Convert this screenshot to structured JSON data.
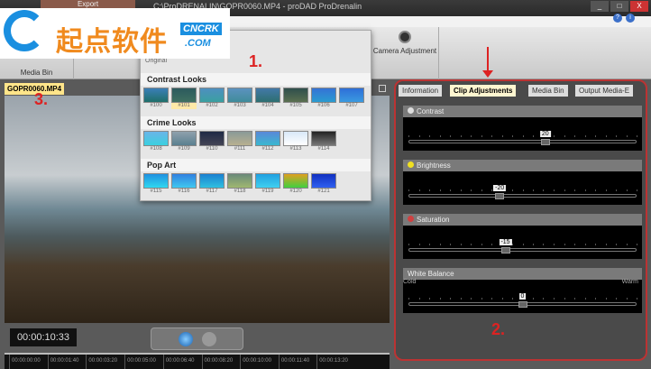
{
  "titlebar": {
    "export_tab": "Export",
    "title": "C:\\ProDRENALIN\\GOPR0060.MP4 - proDAD ProDrenalin",
    "minimize": "_",
    "maximize": "□",
    "close": "X"
  },
  "watermark": {
    "brand_cn": "起点软件",
    "brand_en": "CNCRK",
    "domain": ".COM"
  },
  "ribbon": {
    "media_bin": "Media Bin",
    "camera_adjustment": "Camera Adjustment",
    "original": "Original"
  },
  "popup": {
    "annotation": "1.",
    "sections": [
      {
        "title": "Contrast Looks",
        "items": [
          "#100",
          "#101",
          "#102",
          "#103",
          "#104",
          "#105",
          "#106",
          "#107"
        ]
      },
      {
        "title": "Crime Looks",
        "items": [
          "#108",
          "#109",
          "#110",
          "#111",
          "#112",
          "#113",
          "#114"
        ]
      },
      {
        "title": "Pop Art",
        "items": [
          "#115",
          "#116",
          "#117",
          "#118",
          "#119",
          "#120",
          "#121"
        ]
      }
    ]
  },
  "video": {
    "tab": "GOPR0060.MP4",
    "annotation": "3.",
    "timecode": "00:00:10:33"
  },
  "timeline": {
    "ticks": [
      "00:00:00:00",
      "00:00:01:40",
      "00:00:03:20",
      "00:00:05:00",
      "00:00:06:40",
      "00:00:08:20",
      "00:00:10:00",
      "00:00:11:40",
      "00:00:13:20"
    ]
  },
  "panel": {
    "annotation": "2.",
    "tabs": [
      "Information",
      "Clip Adjustments",
      "Media Bin",
      "Output Media-E"
    ],
    "sliders": [
      {
        "label": "Contrast",
        "value": "20",
        "fraction": 0.6
      },
      {
        "label": "Brightness",
        "value": "-20",
        "fraction": 0.4
      },
      {
        "label": "Saturation",
        "value": "-15",
        "fraction": 0.425
      },
      {
        "label": "White Balance",
        "value": "0",
        "fraction": 0.5,
        "min_label": "Cold",
        "max_label": "Warm"
      }
    ]
  }
}
